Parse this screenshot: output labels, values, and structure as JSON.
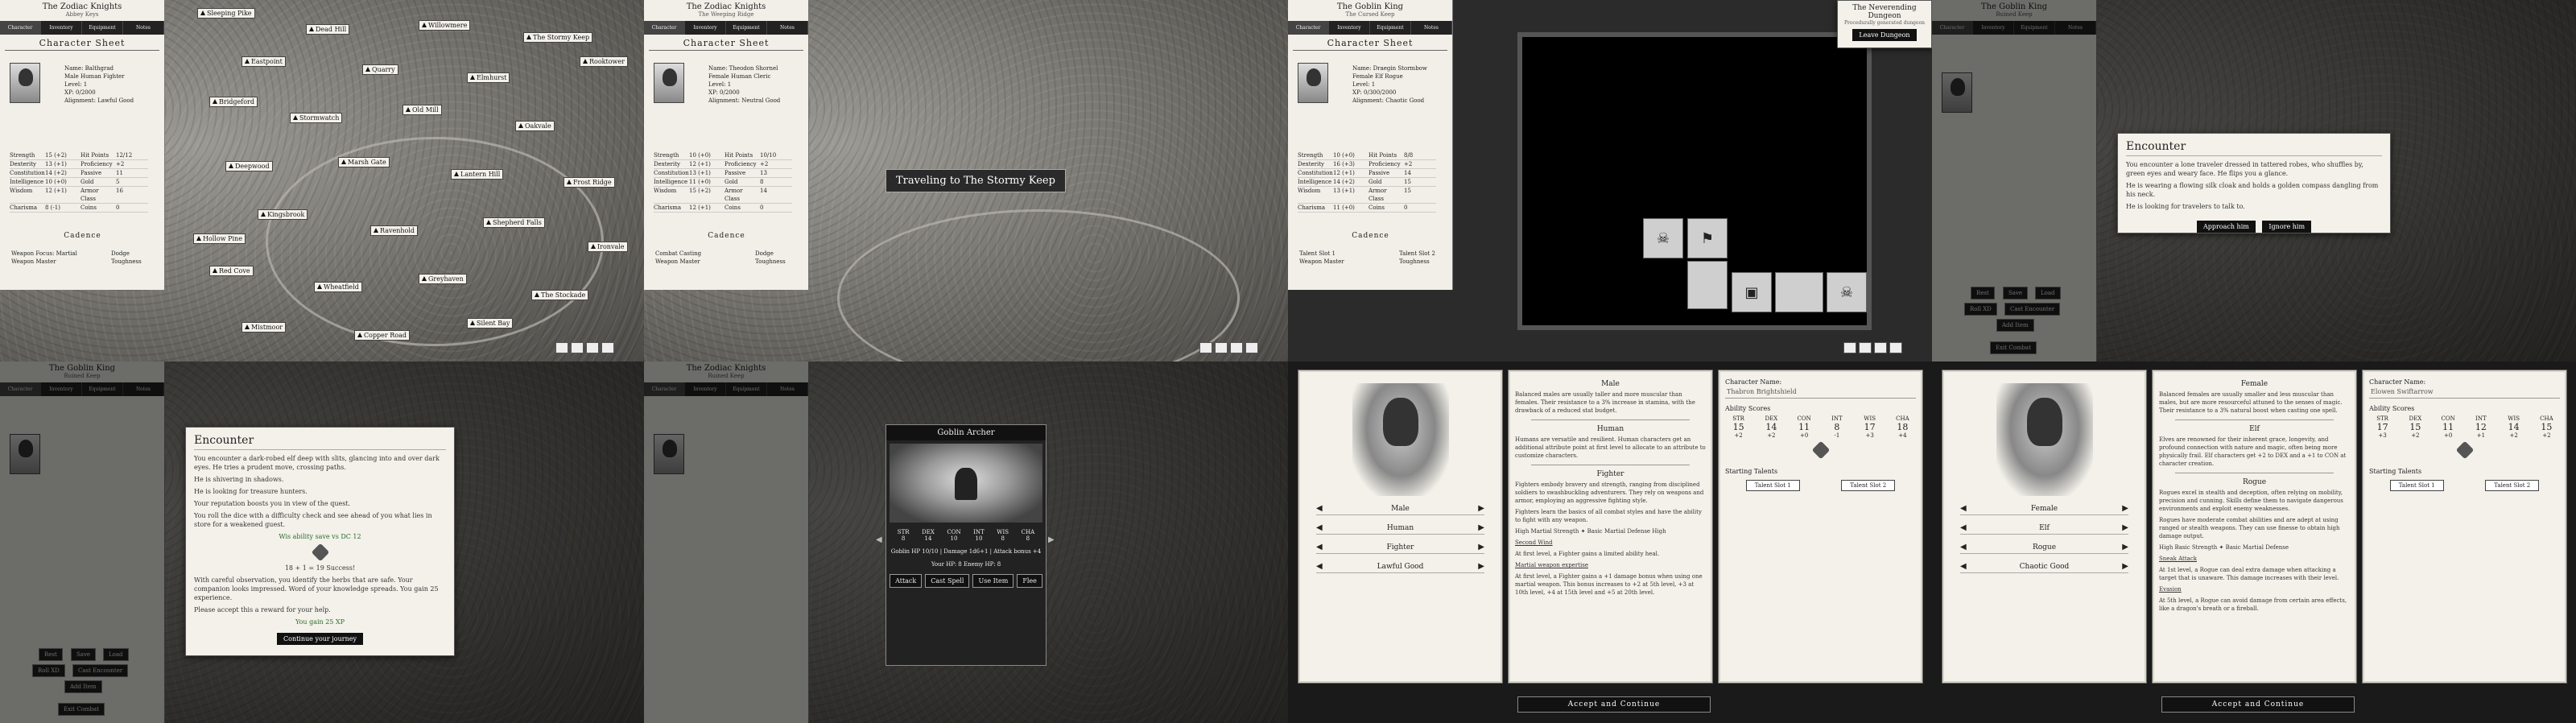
{
  "tabs": [
    "Character",
    "Inventory",
    "Equipment",
    "Notes"
  ],
  "p1": {
    "title": "The Zodiac Knights",
    "subtitle": "Abbey Keys",
    "sheet": "Character Sheet",
    "fields": [
      "Name: Balthgrad",
      "Male Human Fighter",
      "Level: 1",
      "XP: 0/2000",
      "Alignment: Lawful Good"
    ],
    "stats": [
      [
        "Strength",
        "15 (+2)",
        "Hit Points",
        "12/12"
      ],
      [
        "Dexterity",
        "13 (+1)",
        "Proficiency",
        "+2"
      ],
      [
        "Constitution",
        "14 (+2)",
        "Passive",
        "11"
      ],
      [
        "Intelligence",
        "10 (+0)",
        "Gold",
        "5"
      ],
      [
        "Wisdom",
        "12 (+1)",
        "Armor Class",
        "16"
      ],
      [
        "Charisma",
        "8 (-1)",
        "Coins",
        "0"
      ]
    ],
    "cadence": "Cadence",
    "cad_items": [
      "Weapon Focus: Martial",
      "Dodge",
      "Weapon Master",
      "Toughness"
    ],
    "towns": [
      "Sleeping Pike",
      "Dead Hill",
      "Willowmere",
      "The Stormy Keep",
      "Eastpoint",
      "Quarry",
      "Elmhurst",
      "Rooktower",
      "Bridgeford",
      "Stormwatch",
      "Old Mill",
      "Oakvale",
      "Deepwood",
      "Marsh Gate",
      "Lantern Hill",
      "Frost Ridge",
      "Kingsbrook",
      "Ravenhold",
      "Shepherd Falls",
      "Ironvale",
      "Red Cove",
      "Wheatfield",
      "Greyhaven",
      "The Stockade",
      "Mistmoor",
      "Copper Road",
      "Silent Bay",
      "Hollow Pine"
    ]
  },
  "p2": {
    "title": "The Zodiac Knights",
    "subtitle": "The Weeping Ridge",
    "sheet": "Character Sheet",
    "fields": [
      "Name: Theodon Shornel",
      "Female Human Cleric",
      "Level: 1",
      "XP: 0/2000",
      "Alignment: Neutral Good"
    ],
    "stats": [
      [
        "Strength",
        "10 (+0)",
        "Hit Points",
        "10/10"
      ],
      [
        "Dexterity",
        "12 (+1)",
        "Proficiency",
        "+2"
      ],
      [
        "Constitution",
        "13 (+1)",
        "Passive",
        "13"
      ],
      [
        "Intelligence",
        "11 (+0)",
        "Gold",
        "8"
      ],
      [
        "Wisdom",
        "15 (+2)",
        "Armor Class",
        "14"
      ],
      [
        "Charisma",
        "12 (+1)",
        "Coins",
        "0"
      ]
    ],
    "cadence": "Cadence",
    "cad_items": [
      "Combat Casting",
      "Dodge",
      "Weapon Master",
      "Toughness"
    ],
    "travel_banner": "Traveling to The Stormy Keep"
  },
  "p3": {
    "title": "The Goblin King",
    "subtitle": "The Cursed Keep",
    "sheet": "Character Sheet",
    "fields": [
      "Name: Draegin Stormbow",
      "Female Elf Rogue",
      "Level: 1",
      "XP: 0/300/2000",
      "Alignment: Chaotic Good"
    ],
    "stats": [
      [
        "Strength",
        "10 (+0)",
        "Hit Points",
        "8/8"
      ],
      [
        "Dexterity",
        "16 (+3)",
        "Proficiency",
        "+2"
      ],
      [
        "Constitution",
        "12 (+1)",
        "Passive",
        "14"
      ],
      [
        "Intelligence",
        "14 (+2)",
        "Gold",
        "15"
      ],
      [
        "Wisdom",
        "13 (+1)",
        "Armor Class",
        "15"
      ],
      [
        "Charisma",
        "11 (+0)",
        "Coins",
        "0"
      ]
    ],
    "cadence": "Cadence",
    "cad_items": [
      "Talent Slot 1",
      "Talent Slot 2",
      "Weapon Master",
      "Toughness"
    ],
    "dungeon_title": "The Neverending Dungeon",
    "dungeon_sub": "Procedurally generated dungeon",
    "dungeon_btn": "Leave Dungeon"
  },
  "p4": {
    "title": "The Goblin King",
    "subtitle": "Ruined Keep",
    "encounter_title": "Encounter",
    "encounter_text": "You encounter a lone traveler dressed in tattered robes, who shuffles by, green eyes and weary face. He flips you a glance.",
    "encounter_text2": "He is wearing a flowing silk cloak and holds a golden compass dangling from his neck.",
    "encounter_text3": "He is looking for travelers to talk to.",
    "btn_approach": "Approach him",
    "btn_ignore": "Ignore him",
    "side_btns": [
      "Rest",
      "Save",
      "Load",
      "Roll XD",
      "Cast Encounter",
      "Add Item"
    ],
    "combat_btn": "Exit Combat"
  },
  "p5": {
    "title": "The Goblin King",
    "subtitle": "Ruined Keep",
    "encounter_title": "Encounter",
    "lines": [
      "You encounter a dark-robed elf deep with slits, glancing into and over dark eyes. He tries a prudent move, crossing paths.",
      "He is shivering in shadows.",
      "He is looking for treasure hunters.",
      "Your reputation boosts you in view of the quest.",
      "You roll the dice with a difficulty check and see ahead of you what lies in store for a weakened guest."
    ],
    "roll_label": "Wis ability save vs DC 12",
    "roll_result": "18 + 1 = 19 Success!",
    "after_text": "With careful observation, you identify the herbs that are safe. Your companion looks impressed. Word of your knowledge spreads. You gain 25 experience.",
    "please": "Please accept this a reward for your help.",
    "gain": "You gain 25 XP",
    "btn": "Continue your journey",
    "side_btns": [
      "Rest",
      "Save",
      "Load",
      "Roll XD",
      "Cast Encounter",
      "Add Item"
    ],
    "combat_btn": "Exit Combat"
  },
  "p6": {
    "title": "The Zodiac Knights",
    "subtitle": "Ruined Keep",
    "goblin_title": "Goblin Archer",
    "stat_labels": [
      "STR",
      "DEX",
      "CON",
      "INT",
      "WIS",
      "CHA"
    ],
    "stat_vals": [
      "8",
      "14",
      "10",
      "10",
      "8",
      "8"
    ],
    "line1": "Goblin HP 10/10  |  Damage 1d6+1  |  Attack bonus +4",
    "line2": "Your HP: 8          Enemy HP: 8",
    "btns": [
      "Attack",
      "Cast Spell",
      "Use Item",
      "Flee"
    ]
  },
  "c1": {
    "gender_hdr": "Male",
    "gender_text": "Balanced males are usually taller and more muscular than females. Their resistance to a 3% increase in stamina, with the drawback of a reduced stat budget.",
    "race_hdr": "Human",
    "race_text": "Humans are versatile and resilient. Human characters get an additional attribute point at first level to allocate to an attribute to customize characters.",
    "class_hdr": "Fighter",
    "class_text": "Fighters embody bravery and strength, ranging from disciplined soldiers to swashbuckling adventurers. They rely on weapons and armor, employing an aggressive fighting style.",
    "class_text2": "Fighters learn the basics of all combat styles and have the ability to fight with any weapon.",
    "hp_text": "High  Martial Strength  ✦  Basic Martial Defense  High",
    "feature_hdr": "Second Wind",
    "feature_text": "At first level, a Fighter gains a limited ability heal.",
    "martial_hdr": "Martial weapon expertise",
    "martial_text": "At first level, a Fighter gains a +1 damage bonus when using one martial weapon. This bonus increases to +2 at 5th level, +3 at 10th level, +4 at 15th level and +5 at 20th level.",
    "selects": [
      "Male",
      "Human",
      "Fighter",
      "Lawful Good"
    ],
    "name_label": "Character Name:",
    "name_value": "Thabron Brightshield",
    "ability_label": "Ability Scores",
    "score_labels": [
      "STR",
      "DEX",
      "CON",
      "INT",
      "WIS",
      "CHA"
    ],
    "scores": [
      "15",
      "14",
      "11",
      "8",
      "17",
      "18"
    ],
    "mods": [
      "+2",
      "+2",
      "+0",
      "-1",
      "+3",
      "+4"
    ],
    "talents_label": "Starting Talents",
    "talent_btns": [
      "Talent Slot 1",
      "Talent Slot 2"
    ],
    "accept": "Accept and Continue"
  },
  "c2": {
    "gender_hdr": "Female",
    "gender_text": "Balanced females are usually smaller and less muscular than males, but are more resourceful attuned to the senses of magic. Their resistance to a 3% natural boost when casting one spell.",
    "race_hdr": "Elf",
    "race_text": "Elves are renowned for their inherent grace, longevity, and profound connection with nature and magic, often being more physically frail. Elf characters get +2 to DEX and a +1 to CON at character creation.",
    "class_hdr": "Rogue",
    "class_text": "Rogues excel in stealth and deception, often relying on mobility, precision and cunning. Skills define them to navigate dangerous environments and exploit enemy weaknesses.",
    "class_text2": "Rogues have moderate combat abilities and are adept at using ranged or stealth weapons. They can use finesse to obtain high damage output.",
    "hp_text": "High  Basic Strength  ✦  Basic Martial Defense",
    "feature_hdr": "Sneak Attack",
    "feature_text": "At 1st level, a Rogue can deal extra damage when attacking a target that is unaware. This damage increases with their level.",
    "evasion_hdr": "Evasion",
    "evasion_text": "At 5th level, a Rogue can avoid damage from certain area effects, like a dragon's breath or a fireball.",
    "selects": [
      "Female",
      "Elf",
      "Rogue",
      "Chaotic Good"
    ],
    "name_label": "Character Name:",
    "name_value": "Elowen Swiftarrow",
    "ability_label": "Ability Scores",
    "score_labels": [
      "STR",
      "DEX",
      "CON",
      "INT",
      "WIS",
      "CHA"
    ],
    "scores": [
      "17",
      "15",
      "11",
      "12",
      "14",
      "15"
    ],
    "mods": [
      "+3",
      "+2",
      "+0",
      "+1",
      "+2",
      "+2"
    ],
    "talents_label": "Starting Talents",
    "talent_btns": [
      "Talent Slot 1",
      "Talent Slot 2"
    ],
    "accept": "Accept and Continue"
  }
}
